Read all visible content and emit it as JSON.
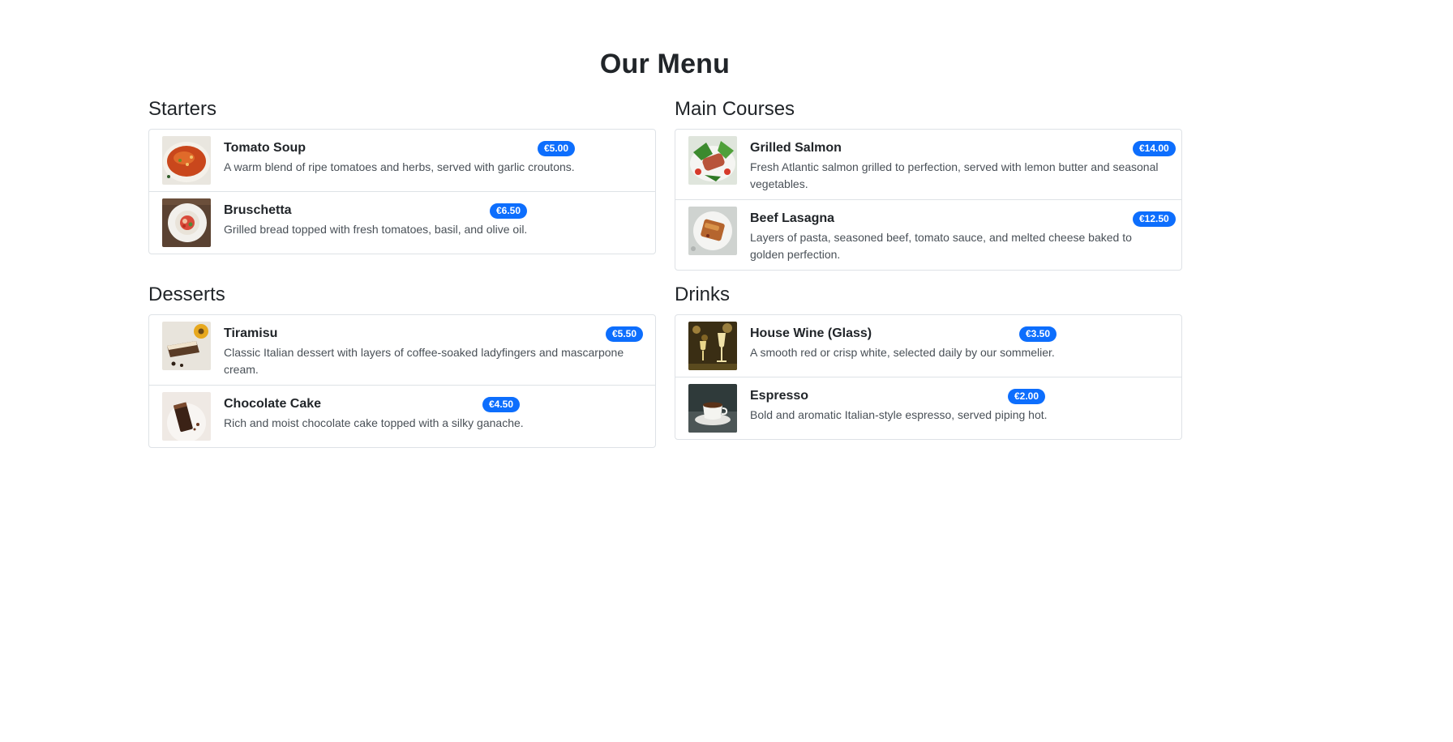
{
  "title": "Our Menu",
  "sections": {
    "starters": {
      "title": "Starters",
      "items": [
        {
          "name": "Tomato Soup",
          "price": "€5.00",
          "description": "A warm blend of ripe tomatoes and herbs, served with garlic croutons."
        },
        {
          "name": "Bruschetta",
          "price": "€6.50",
          "description": "Grilled bread topped with fresh tomatoes, basil, and olive oil."
        }
      ]
    },
    "mains": {
      "title": "Main Courses",
      "items": [
        {
          "name": "Grilled Salmon",
          "price": "€14.00",
          "description": "Fresh Atlantic salmon grilled to perfection, served with lemon butter and seasonal vegetables."
        },
        {
          "name": "Beef Lasagna",
          "price": "€12.50",
          "description": "Layers of pasta, seasoned beef, tomato sauce, and melted cheese baked to golden perfection."
        }
      ]
    },
    "desserts": {
      "title": "Desserts",
      "items": [
        {
          "name": "Tiramisu",
          "price": "€5.50",
          "description": "Classic Italian dessert with layers of coffee-soaked ladyfingers and mascarpone cream."
        },
        {
          "name": "Chocolate Cake",
          "price": "€4.50",
          "description": "Rich and moist chocolate cake topped with a silky ganache."
        }
      ]
    },
    "drinks": {
      "title": "Drinks",
      "items": [
        {
          "name": "House Wine (Glass)",
          "price": "€3.50",
          "description": "A smooth red or crisp white, selected daily by our sommelier."
        },
        {
          "name": "Espresso",
          "price": "€2.00",
          "description": "Bold and aromatic Italian-style espresso, served piping hot."
        }
      ]
    }
  },
  "colors": {
    "accent": "#0d6efd",
    "border": "#dee2e6",
    "text": "#212529",
    "muted": "#495057"
  }
}
